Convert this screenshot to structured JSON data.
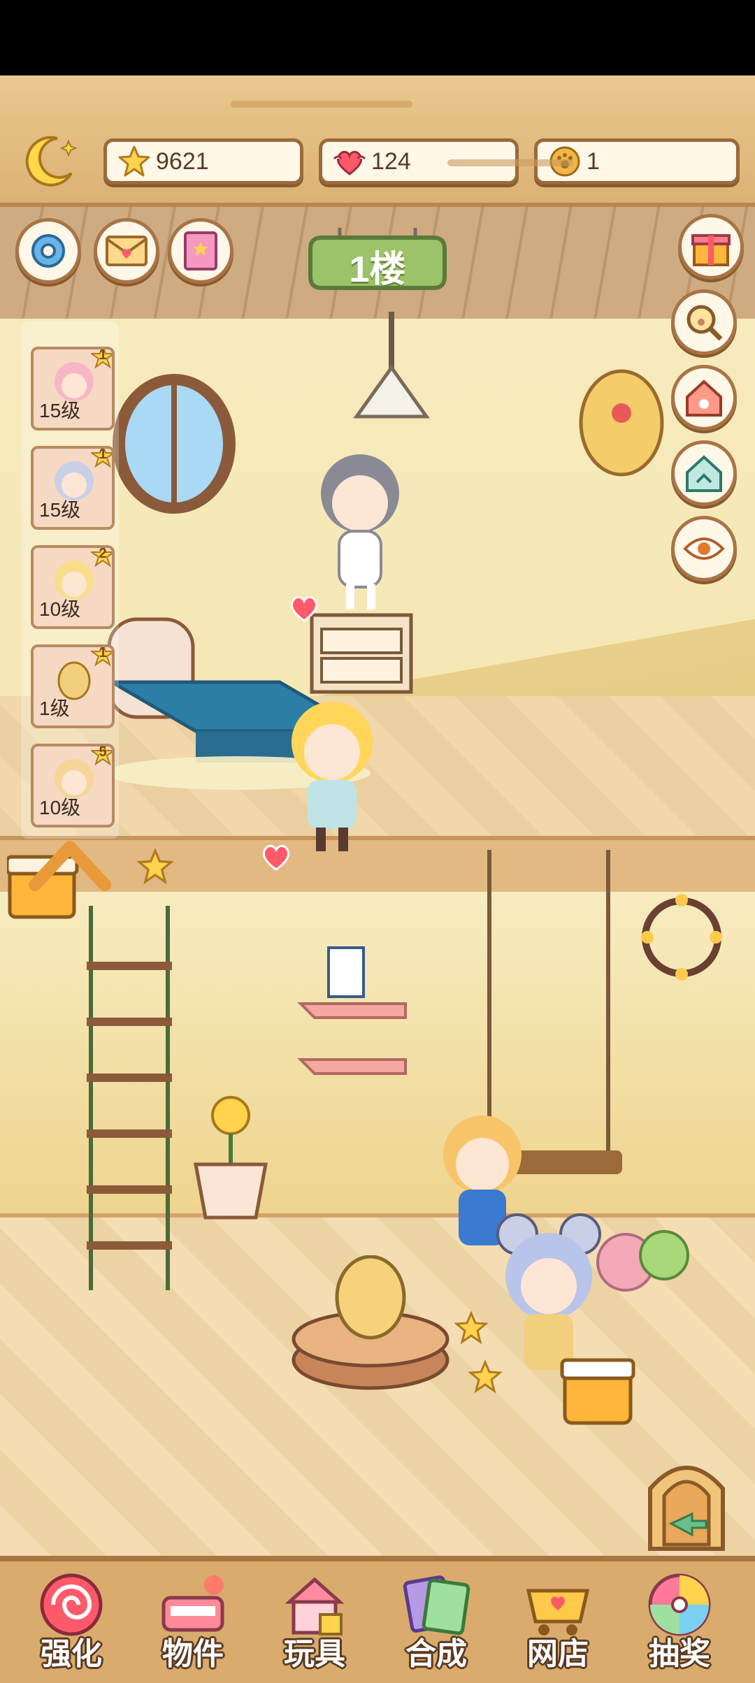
{
  "resources": {
    "stars": "9621",
    "hearts": "124",
    "coins": "1"
  },
  "floor_sign": "1楼",
  "characters": [
    {
      "level": "15级",
      "badge": "1",
      "color": "#f7b6c6"
    },
    {
      "level": "15级",
      "badge": "1",
      "color": "#c9cfe6"
    },
    {
      "level": "10级",
      "badge": "2",
      "color": "#f8de8a"
    },
    {
      "level": "1级",
      "badge": "1",
      "color": "#f2cf7c"
    },
    {
      "level": "10级",
      "badge": "5",
      "color": "#f7d49a"
    }
  ],
  "nav": {
    "enhance": "强化",
    "items": "物件",
    "toys": "玩具",
    "merge": "合成",
    "shop": "网店",
    "lottery": "抽奖"
  },
  "icons": {
    "top_left": [
      "moon-icon"
    ],
    "scene_left": [
      "settings-gear-icon",
      "mail-envelope-icon",
      "book-icon"
    ],
    "scene_right": [
      "gift-box-icon",
      "paw-magnifier-icon",
      "house-paw-icon",
      "home-share-icon",
      "eye-icon"
    ],
    "bottom_right": "exit-door-icon"
  },
  "colors": {
    "frame_brown": "#9b6a3a",
    "topbar": "#dcb274",
    "sign_green": "#9cc26a"
  }
}
